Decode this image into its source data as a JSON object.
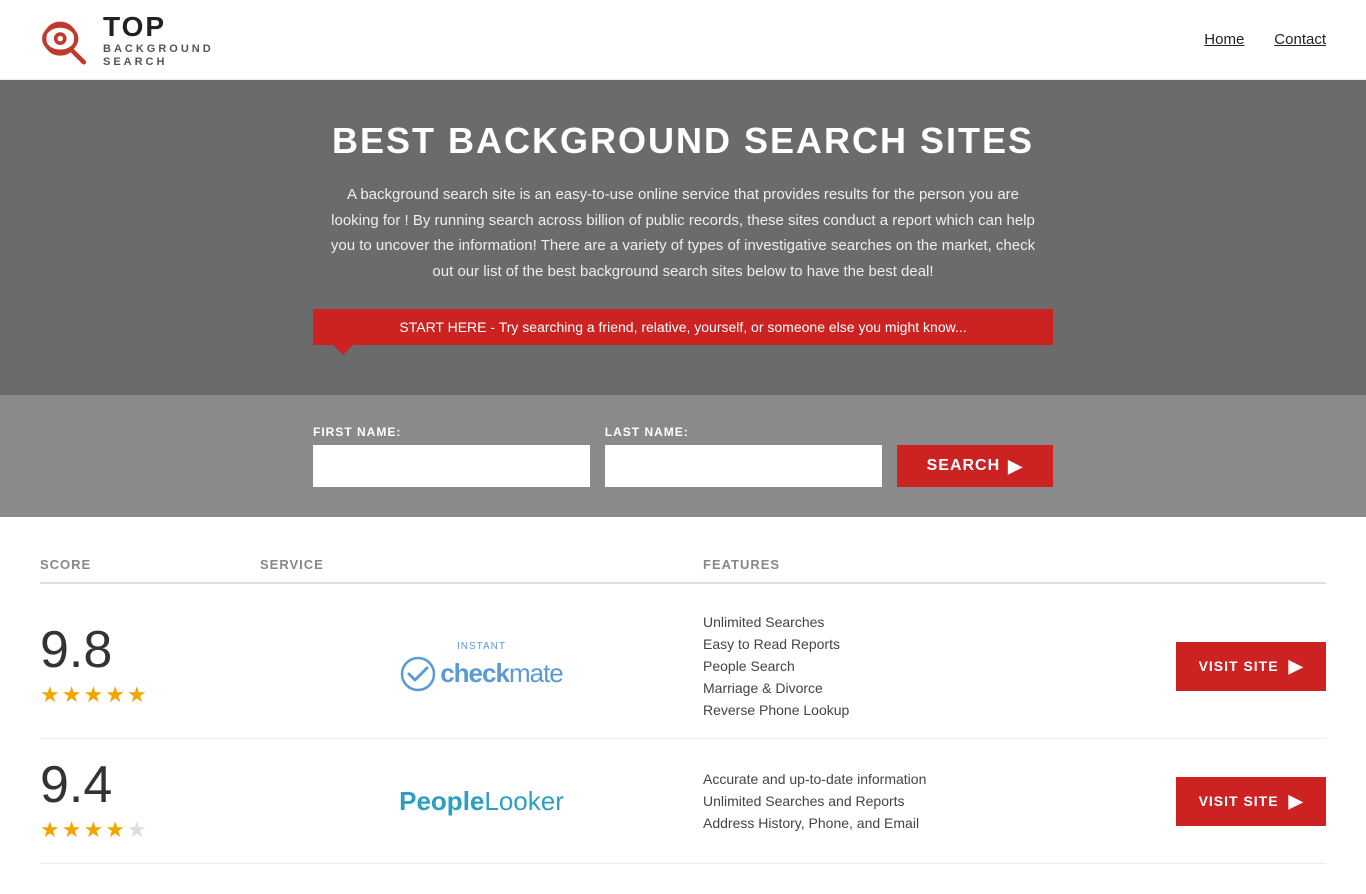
{
  "header": {
    "logo": {
      "top": "TOP",
      "bottom": "BACKGROUND\nSEARCH",
      "alt": "Top Background Search"
    },
    "nav": [
      {
        "label": "Home",
        "href": "#"
      },
      {
        "label": "Contact",
        "href": "#"
      }
    ]
  },
  "hero": {
    "title": "BEST BACKGROUND SEARCH SITES",
    "description": "A background search site is an easy-to-use online service that provides results  for the person you are looking for ! By  running  search across billion of public records, these sites conduct  a report which can help you to uncover the information! There are a variety of types of investigative searches on the market, check out our  list of the best background search sites below to have the best deal!",
    "search_tip": "START HERE - Try searching a friend, relative, yourself, or someone else you might know..."
  },
  "search_form": {
    "first_name_label": "FIRST NAME:",
    "last_name_label": "LAST NAME:",
    "first_name_placeholder": "",
    "last_name_placeholder": "",
    "button_label": "SEARCH"
  },
  "table": {
    "headers": {
      "score": "SCORE",
      "service": "SERVICE",
      "features": "FEATURES",
      "action": ""
    },
    "rows": [
      {
        "score": "9.8",
        "stars": 5,
        "service_name": "Instant Checkmate",
        "service_label_top": "instant",
        "service_label_check": "check",
        "service_label_mate": "mate",
        "features": [
          "Unlimited Searches",
          "Easy to Read Reports",
          "People Search",
          "Marriage & Divorce",
          "Reverse Phone Lookup"
        ],
        "visit_label": "VISIT SITE"
      },
      {
        "score": "9.4",
        "stars": 4,
        "service_name": "PeopleLooker",
        "features": [
          "Accurate and up-to-date information",
          "Unlimited Searches and Reports",
          "Address History, Phone, and Email"
        ],
        "visit_label": "VISIT SITE"
      }
    ]
  }
}
